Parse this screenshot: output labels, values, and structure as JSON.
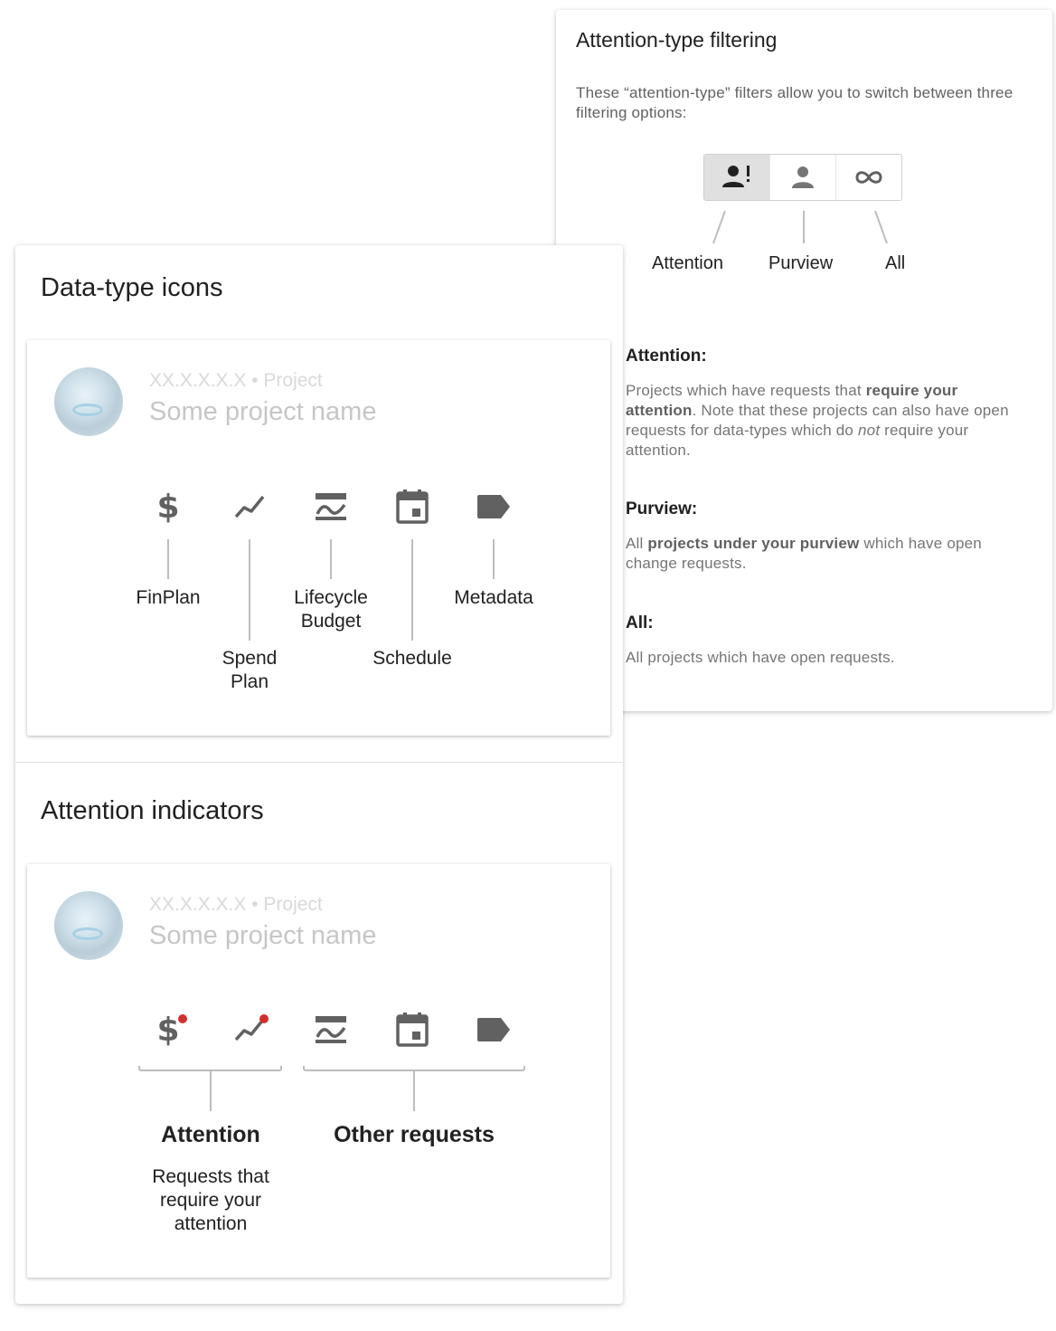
{
  "filter_card": {
    "title": "Attention-type filtering",
    "intro": "These “attention-type” filters allow you to switch between three filtering options:",
    "toggles": [
      {
        "icon": "person-alert-icon",
        "active": true
      },
      {
        "icon": "person-icon",
        "active": false
      },
      {
        "icon": "infinity-icon",
        "active": false
      }
    ],
    "options": [
      "Attention",
      "Purview",
      "All"
    ],
    "descriptions": {
      "attention": {
        "heading": "Attention:",
        "t1": "Projects which have requests that ",
        "b1": "require your attention",
        "t2": ".  Note that these projects can also have open requests for data-types which do ",
        "i1": "not",
        "t3": " require your attention."
      },
      "purview": {
        "heading": "Purview:",
        "t1": "All ",
        "b1": "projects under your purview",
        "t2": " which have open change requests."
      },
      "all": {
        "heading": "All:",
        "t1": "All projects which have open requests."
      }
    }
  },
  "datatype_section": {
    "title": "Data-type icons",
    "project": {
      "sub": "XX.X.X.X.X • Project",
      "name": "Some project name"
    },
    "icons": [
      {
        "icon": "dollar-icon",
        "glyph": "$"
      },
      {
        "icon": "trend-line-icon"
      },
      {
        "icon": "budget-curve-icon"
      },
      {
        "icon": "calendar-icon"
      },
      {
        "icon": "label-tag-icon"
      }
    ],
    "labels": {
      "finplan": "FinPlan",
      "spend_plan": "Spend Plan",
      "lifecycle_budget": "Lifecycle Budget",
      "schedule": "Schedule",
      "metadata": "Metadata"
    }
  },
  "attention_section": {
    "title": "Attention indicators",
    "project": {
      "sub": "XX.X.X.X.X • Project",
      "name": "Some project name"
    },
    "attention_label": "Attention",
    "attention_desc": "Requests that require your attention",
    "other_label": "Other requests",
    "indicator_color": "#d32f2f"
  },
  "colors": {
    "icon": "#616161",
    "muted_text": "#757575",
    "accent_dot": "#d32f2f"
  }
}
